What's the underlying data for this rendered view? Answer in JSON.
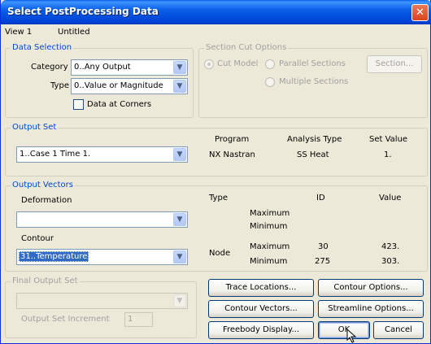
{
  "window": {
    "title": "Select PostProcessing Data",
    "close_glyph": "✕"
  },
  "view": {
    "name": "View 1",
    "title": "Untitled"
  },
  "data_selection": {
    "legend": "Data Selection",
    "category_label": "Category",
    "category_value": "0..Any Output",
    "type_label": "Type",
    "type_value": "0..Value or Magnitude",
    "data_at_corners_label": "Data at Corners"
  },
  "section_cut": {
    "legend": "Section Cut Options",
    "cut_model": "Cut Model",
    "parallel_sections": "Parallel Sections",
    "multiple_sections": "Multiple Sections",
    "section_button": "Section..."
  },
  "output_set": {
    "legend": "Output Set",
    "selected": "1..Case 1 Time 1.",
    "headers": {
      "program": "Program",
      "analysis_type": "Analysis Type",
      "set_value": "Set Value"
    },
    "values": {
      "program": "NX Nastran",
      "analysis_type": "SS Heat",
      "set_value": "1."
    }
  },
  "output_vectors": {
    "legend": "Output Vectors",
    "deformation_label": "Deformation",
    "deformation_value": "",
    "contour_label": "Contour",
    "contour_value": "31..Temperature",
    "headers": {
      "type": "Type",
      "id": "ID",
      "value": "Value"
    },
    "deformation_rows": [
      {
        "label": "Maximum"
      },
      {
        "label": "Minimum"
      }
    ],
    "contour_type": "Node",
    "contour_rows": [
      {
        "label": "Maximum",
        "id": "30",
        "value": "423."
      },
      {
        "label": "Minimum",
        "id": "275",
        "value": "303."
      }
    ]
  },
  "final_output_set": {
    "legend": "Final Output Set",
    "increment_label": "Output Set Increment",
    "increment_value": "1"
  },
  "buttons": {
    "trace_locations": "Trace Locations...",
    "contour_options": "Contour Options...",
    "contour_vectors": "Contour Vectors...",
    "streamline_options": "Streamline Options...",
    "freebody_display": "Freebody Display...",
    "ok": "OK",
    "cancel": "Cancel"
  }
}
